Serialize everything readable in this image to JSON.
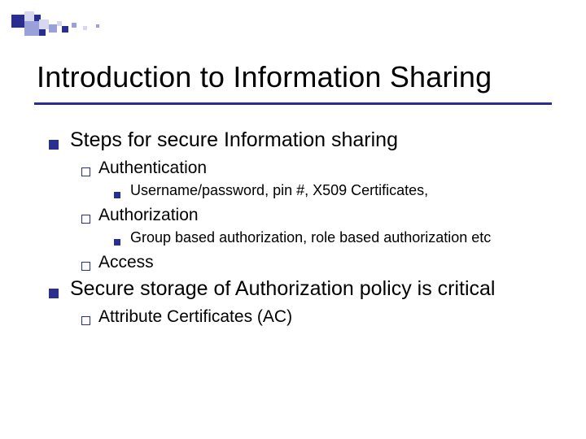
{
  "title": "Introduction to Information Sharing",
  "bullets": [
    {
      "text": "Steps for secure Information sharing",
      "children": [
        {
          "text": "Authentication",
          "children": [
            {
              "text": "Username/password, pin #, X509 Certificates,"
            }
          ]
        },
        {
          "text": "Authorization",
          "children": [
            {
              "text": "Group based authorization, role based authorization etc"
            }
          ]
        },
        {
          "text": "Access"
        }
      ]
    },
    {
      "text": "Secure storage of Authorization policy is critical",
      "children": [
        {
          "text": "Attribute Certificates (AC)"
        }
      ]
    }
  ],
  "deco_colors": {
    "dark": "#2a2f8f",
    "mid": "#9aa0d8",
    "light": "#d5d8ef"
  }
}
